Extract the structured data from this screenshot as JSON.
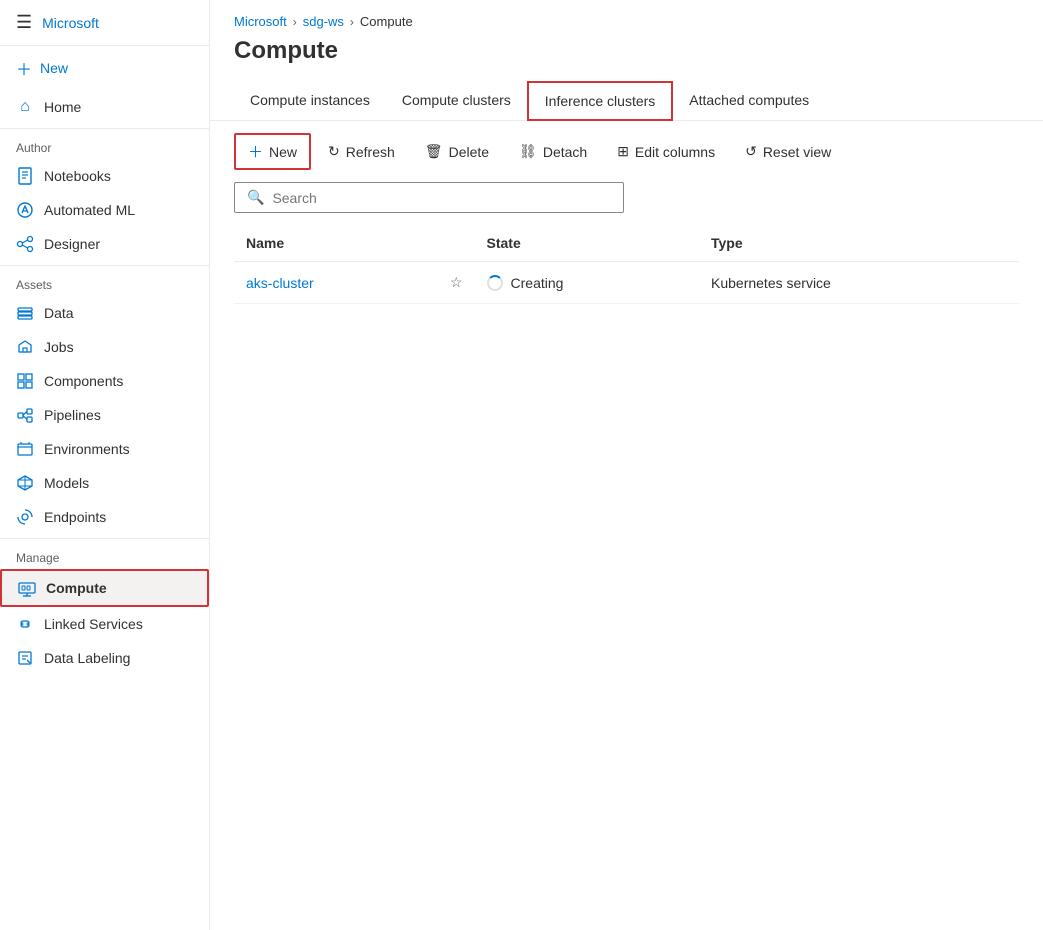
{
  "breadcrumb": {
    "items": [
      "Microsoft",
      "sdg-ws",
      "Compute"
    ],
    "separators": [
      ">",
      ">"
    ]
  },
  "page": {
    "title": "Compute"
  },
  "tabs": [
    {
      "id": "compute-instances",
      "label": "Compute instances",
      "active": false
    },
    {
      "id": "compute-clusters",
      "label": "Compute clusters",
      "active": false
    },
    {
      "id": "inference-clusters",
      "label": "Inference clusters",
      "active": true
    },
    {
      "id": "attached-computes",
      "label": "Attached computes",
      "active": false
    }
  ],
  "toolbar": {
    "new_label": "New",
    "refresh_label": "Refresh",
    "delete_label": "Delete",
    "detach_label": "Detach",
    "edit_columns_label": "Edit columns",
    "reset_view_label": "Reset view"
  },
  "search": {
    "placeholder": "Search"
  },
  "table": {
    "columns": [
      "Name",
      "State",
      "Type"
    ],
    "rows": [
      {
        "name": "aks-cluster",
        "state": "Creating",
        "type": "Kubernetes service"
      }
    ]
  },
  "sidebar": {
    "microsoft_label": "Microsoft",
    "new_label": "New",
    "home_label": "Home",
    "author_label": "Author",
    "author_items": [
      {
        "id": "notebooks",
        "label": "Notebooks",
        "icon": "📓"
      },
      {
        "id": "automated-ml",
        "label": "Automated ML",
        "icon": "⚗"
      },
      {
        "id": "designer",
        "label": "Designer",
        "icon": "🔗"
      }
    ],
    "assets_label": "Assets",
    "assets_items": [
      {
        "id": "data",
        "label": "Data",
        "icon": "📊"
      },
      {
        "id": "jobs",
        "label": "Jobs",
        "icon": "🧪"
      },
      {
        "id": "components",
        "label": "Components",
        "icon": "⬛"
      },
      {
        "id": "pipelines",
        "label": "Pipelines",
        "icon": "🔀"
      },
      {
        "id": "environments",
        "label": "Environments",
        "icon": "📦"
      },
      {
        "id": "models",
        "label": "Models",
        "icon": "🗂"
      },
      {
        "id": "endpoints",
        "label": "Endpoints",
        "icon": "🔁"
      }
    ],
    "manage_label": "Manage",
    "manage_items": [
      {
        "id": "compute",
        "label": "Compute",
        "icon": "🖥",
        "active": true
      },
      {
        "id": "linked-services",
        "label": "Linked Services",
        "icon": "🔗"
      },
      {
        "id": "data-labeling",
        "label": "Data Labeling",
        "icon": "✏"
      }
    ]
  }
}
